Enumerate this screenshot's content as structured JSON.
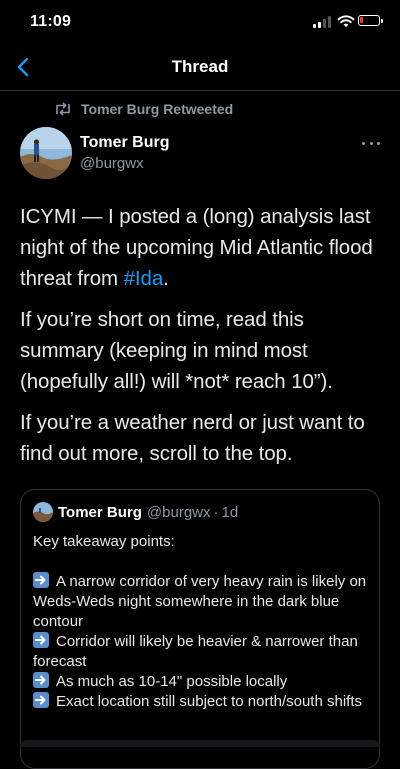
{
  "status_bar": {
    "time": "11:09"
  },
  "header": {
    "title": "Thread"
  },
  "retweet": {
    "text": "Tomer Burg Retweeted"
  },
  "author": {
    "name": "Tomer Burg",
    "handle": "@burgwx"
  },
  "tweet": {
    "p1_before": "ICYMI — I posted a (long) analysis last night of the upcoming Mid Atlantic flood threat from ",
    "p1_hashtag": "#Ida",
    "p1_after": ".",
    "p2": "If you’re short on time, read this summary (keeping in mind most (hopefully all!) will *not* reach 10”).",
    "p3": "If you’re a weather nerd or just want to find out more, scroll to the top."
  },
  "quote": {
    "name": "Tomer Burg",
    "handle": "@burgwx",
    "separator": "·",
    "time": "1d",
    "intro": "Key takeaway points:",
    "bullets": [
      "A narrow corridor of very heavy rain is likely on Weds-Weds night somewhere in the dark blue contour",
      "Corridor will likely be heavier & narrower than forecast",
      "As much as 10-14\" possible locally",
      "Exact location still subject to north/south shifts"
    ]
  },
  "colors": {
    "accent": "#1d9bf0",
    "muted": "#8b98a5",
    "border": "#2f3336",
    "battery_low": "#ff3b30",
    "emoji_blue": "#5a8ec9"
  }
}
